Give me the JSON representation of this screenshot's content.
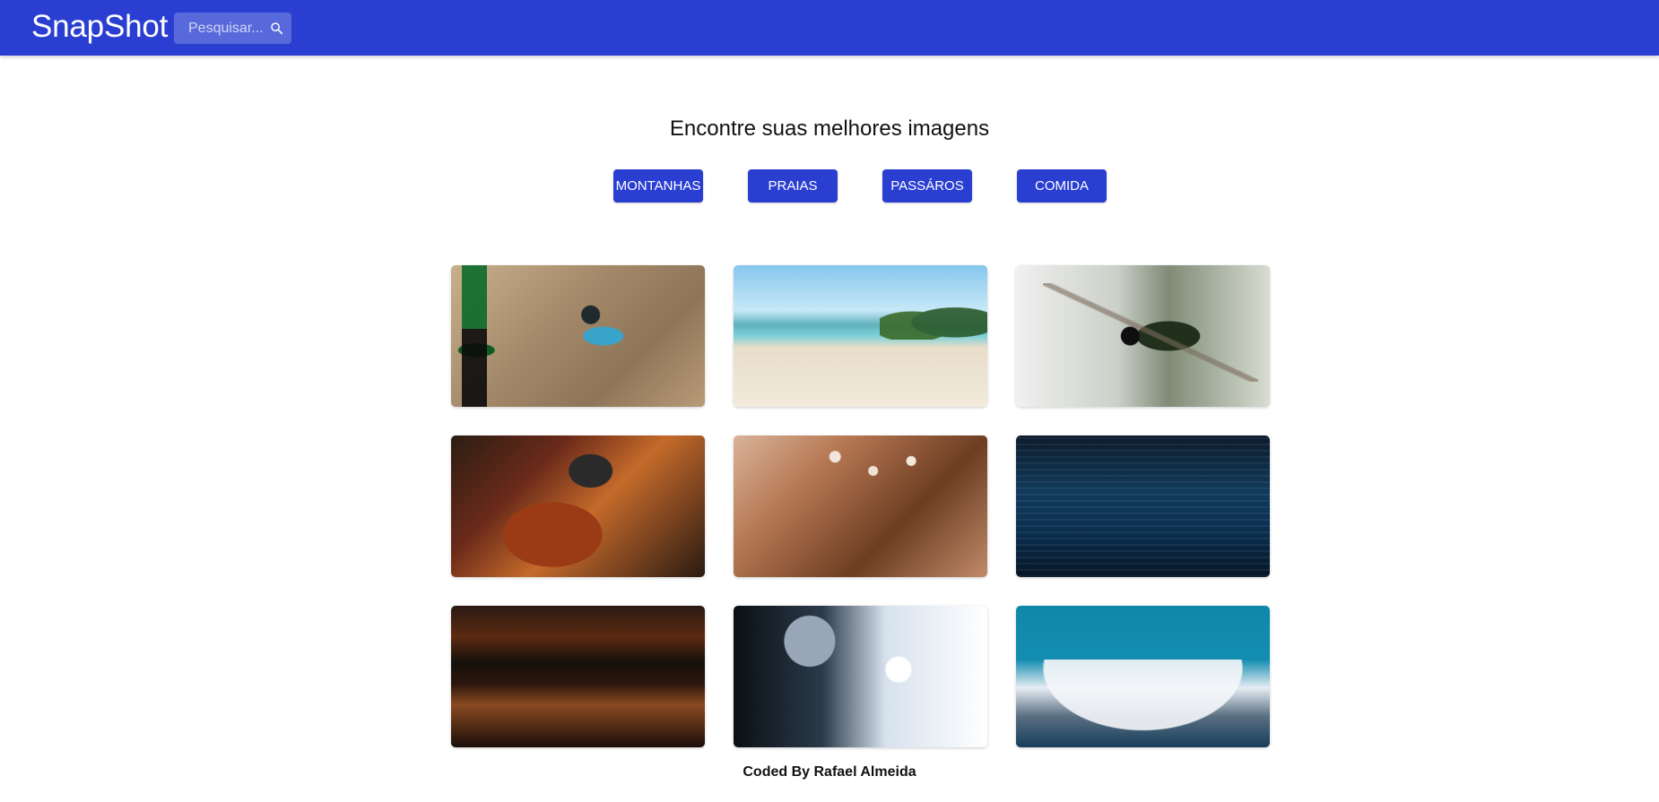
{
  "app": {
    "brand": "SnapShot",
    "search": {
      "placeholder": "Pesquisar...",
      "value": ""
    },
    "colors": {
      "primary": "#2a3fd2",
      "bg": "#ffffff"
    }
  },
  "main": {
    "headline": "Encontre suas melhores imagens",
    "filters": [
      {
        "label": "MONTANHAS"
      },
      {
        "label": "PRAIAS"
      },
      {
        "label": "PASSÁROS"
      },
      {
        "label": "COMIDA"
      }
    ],
    "gallery": [
      {
        "name": "photo-child-dirt"
      },
      {
        "name": "photo-beach"
      },
      {
        "name": "photo-bird-branch"
      },
      {
        "name": "photo-sandwich"
      },
      {
        "name": "photo-flowers-table"
      },
      {
        "name": "photo-ocean-waves"
      },
      {
        "name": "photo-sunset-water"
      },
      {
        "name": "photo-frost-flower"
      },
      {
        "name": "photo-snow-mountain"
      }
    ]
  },
  "footer": {
    "credit": "Coded By Rafael Almeida"
  }
}
